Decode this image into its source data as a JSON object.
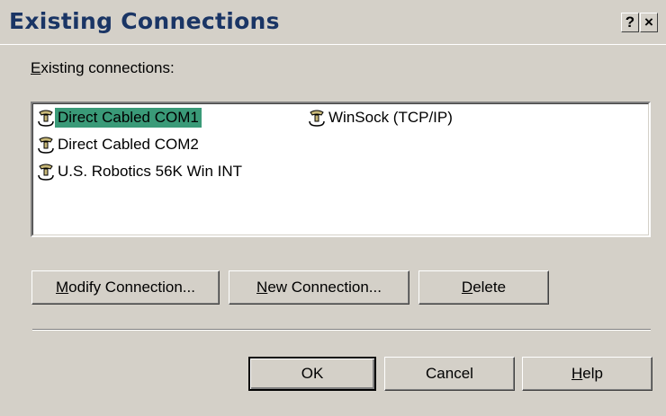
{
  "dialog": {
    "title": "Existing Connections",
    "help_button": "?",
    "close_button": "×"
  },
  "connections_label": {
    "accel": "E",
    "rest": "xisting connections:"
  },
  "connections": [
    {
      "label": "Direct Cabled COM1",
      "selected": true,
      "icon": "phone-icon"
    },
    {
      "label": "Direct Cabled COM2",
      "selected": false,
      "icon": "phone-icon"
    },
    {
      "label": "U.S. Robotics 56K Win INT",
      "selected": false,
      "icon": "phone-icon"
    },
    {
      "label": "WinSock (TCP/IP)",
      "selected": false,
      "icon": "phone-icon"
    }
  ],
  "buttons": {
    "modify": {
      "accel": "M",
      "rest": "odify Connection..."
    },
    "new": {
      "accel": "N",
      "rest": "ew Connection..."
    },
    "delete": {
      "accel": "D",
      "rest": "elete"
    },
    "ok": {
      "label": "OK"
    },
    "cancel": {
      "label": "Cancel"
    },
    "help": {
      "accel": "H",
      "rest": "elp"
    }
  },
  "colors": {
    "title": "#1a3565",
    "selection": "#3a9a78",
    "face": "#d4d0c8"
  }
}
